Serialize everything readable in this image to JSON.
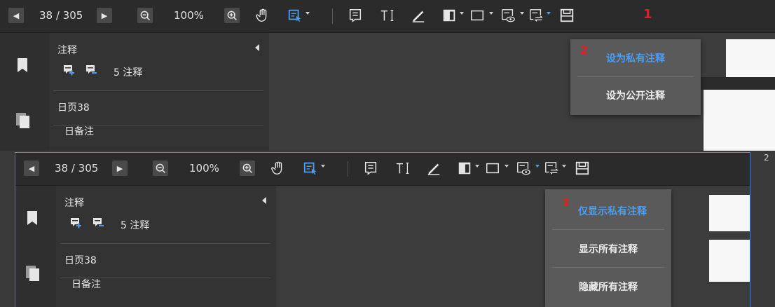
{
  "toolbar": {
    "page_indicator": "38 / 305",
    "zoom_level": "100%"
  },
  "markers": {
    "step1": "1",
    "step2": "2",
    "step3": "3"
  },
  "annotation_panel": {
    "title": "注释",
    "count_label": "5 注释",
    "page_node": "日页38",
    "note_node": "日备注"
  },
  "visibility_menu": {
    "set_private": "设为私有注释",
    "set_public": "设为公开注释"
  },
  "display_menu": {
    "show_private_only": "仅显示私有注释",
    "show_all": "显示所有注释",
    "hide_all": "隐藏所有注释"
  },
  "side_number": "2",
  "colors": {
    "accent": "#4a9df0",
    "marker": "#e02020",
    "toolbar_bg": "#2b2b2b",
    "menu_bg": "#5a5a5a"
  }
}
